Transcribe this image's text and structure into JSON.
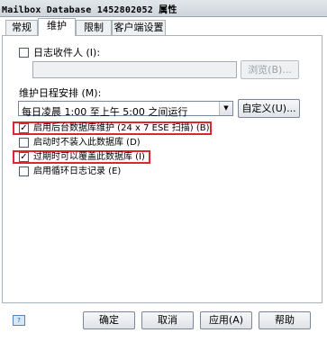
{
  "window": {
    "title": "Mailbox Database 1452802052 属性"
  },
  "tabs": [
    {
      "label": "常规"
    },
    {
      "label": "维护"
    },
    {
      "label": "限制"
    },
    {
      "label": "客户端设置"
    }
  ],
  "journal": {
    "label": "日志收件人 (I):",
    "checked": false,
    "value": "",
    "browse_label": "浏览(B)..."
  },
  "schedule": {
    "label": "维护日程安排 (M):",
    "selected": "每日凌晨 1:00 至上午 5:00 之间运行",
    "custom_label": "自定义(U)..."
  },
  "options": [
    {
      "label": "启用后台数据库维护 (24 x 7 ESE 扫描) (B)",
      "checked": true
    },
    {
      "label": "启动时不装入此数据库 (D)",
      "checked": false
    },
    {
      "label": "过期时可以覆盖此数据库 (I)",
      "checked": true
    },
    {
      "label": "启用循环日志记录 (E)",
      "checked": false
    }
  ],
  "buttons": {
    "ok": "确定",
    "cancel": "取消",
    "apply": "应用(A)",
    "help": "帮助"
  },
  "colors": {
    "highlight_border": "#e0262b"
  }
}
